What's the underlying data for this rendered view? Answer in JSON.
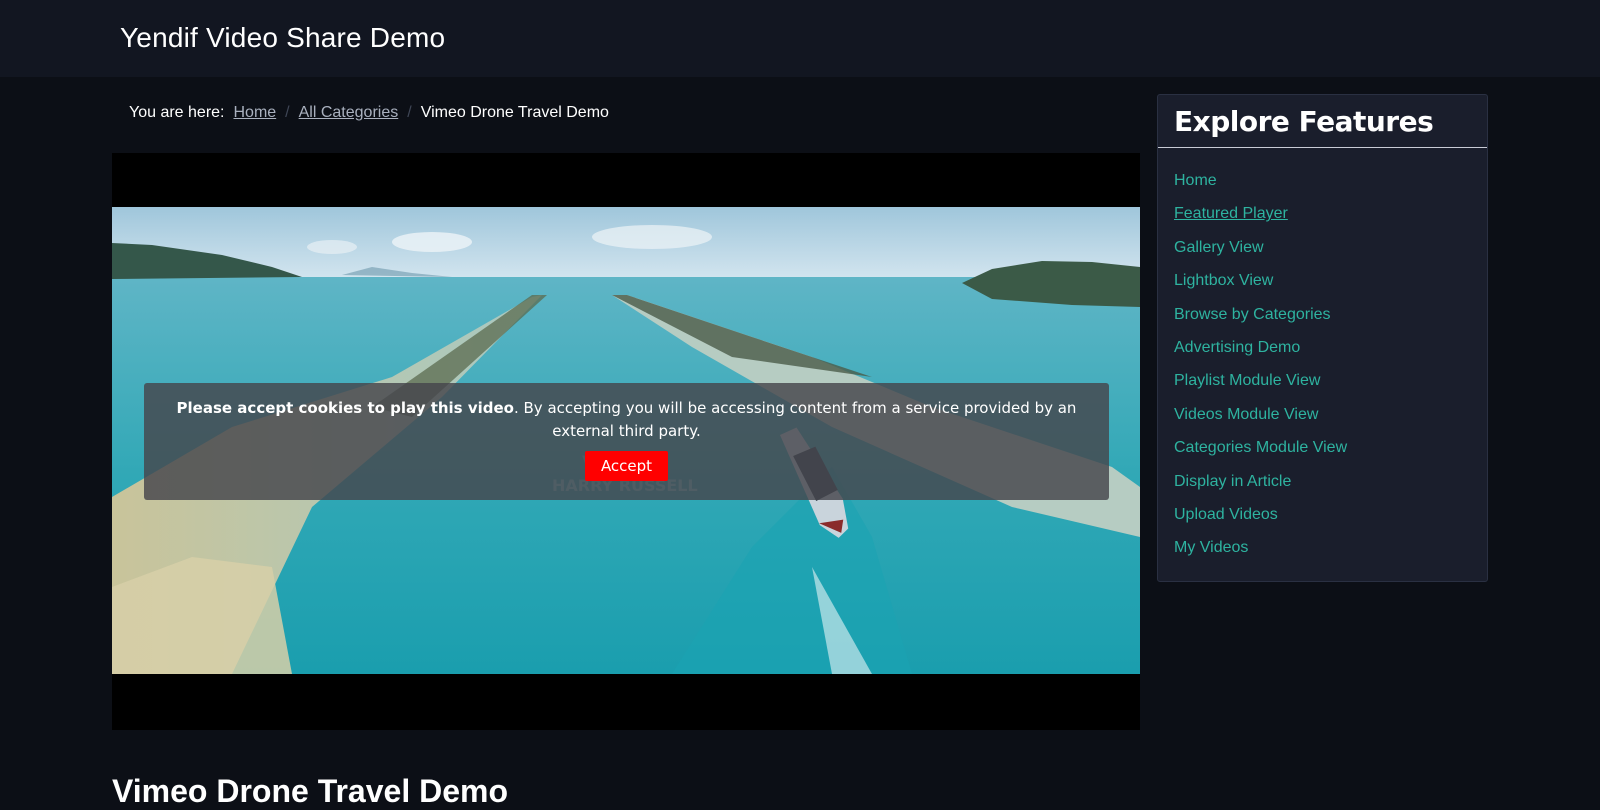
{
  "header": {
    "site_title": "Yendif Video Share Demo"
  },
  "breadcrumb": {
    "prefix": "You are here:",
    "items": [
      "Home",
      "All Categories"
    ],
    "current": "Vimeo Drone Travel Demo"
  },
  "player": {
    "consent": {
      "bold_text": "Please accept cookies to play this video",
      "rest_text": ". By accepting you will be accessing content from a service provided by an external third party.",
      "accept_label": "Accept"
    }
  },
  "content": {
    "video_title": "Vimeo Drone Travel Demo"
  },
  "sidebar": {
    "title": "Explore Features",
    "items": [
      {
        "label": "Home"
      },
      {
        "label": "Featured Player"
      },
      {
        "label": "Gallery View"
      },
      {
        "label": "Lightbox View"
      },
      {
        "label": "Browse by Categories"
      },
      {
        "label": "Advertising Demo"
      },
      {
        "label": "Playlist Module View"
      },
      {
        "label": "Videos Module View"
      },
      {
        "label": "Categories Module View"
      },
      {
        "label": "Display in Article"
      },
      {
        "label": "Upload Videos"
      },
      {
        "label": "My Videos"
      }
    ]
  },
  "colors": {
    "page_bg": "#0c0f16",
    "header_bg": "#121621",
    "sidebar_bg": "#1a1e2c",
    "link_accent": "#2eb3a0",
    "accept_button": "#ff0000"
  }
}
